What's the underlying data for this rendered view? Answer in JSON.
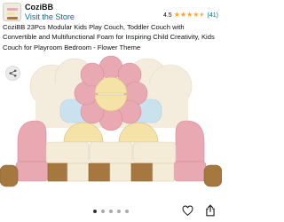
{
  "store": {
    "name": "CoziBB",
    "link": "Visit the Store",
    "logo_icon": "store-logo-icon"
  },
  "rating": {
    "value": "4.5",
    "stars": 4.5,
    "count": "(41)",
    "star_color": "#ffa41c"
  },
  "product": {
    "title": "CoziBB 23Pcs Modular Kids Play Couch, Toddler Couch with Convertible and Multifunctional Foam for Inspiring Child Creativity, Kids Couch for Playroom Bedroom - Flower Theme"
  },
  "carousel": {
    "dot_count": 5,
    "active_index": 0
  },
  "icons": {
    "share": "share-icon",
    "favorite": "heart-icon",
    "upload": "upload-icon"
  },
  "colors": {
    "link": "#007185",
    "text": "#0f1111",
    "pink": "#e8a9b3",
    "yellow": "#f4e2a6",
    "brown": "#a5783f",
    "cream": "#f4ecdc",
    "blue": "#c9e2ee"
  }
}
